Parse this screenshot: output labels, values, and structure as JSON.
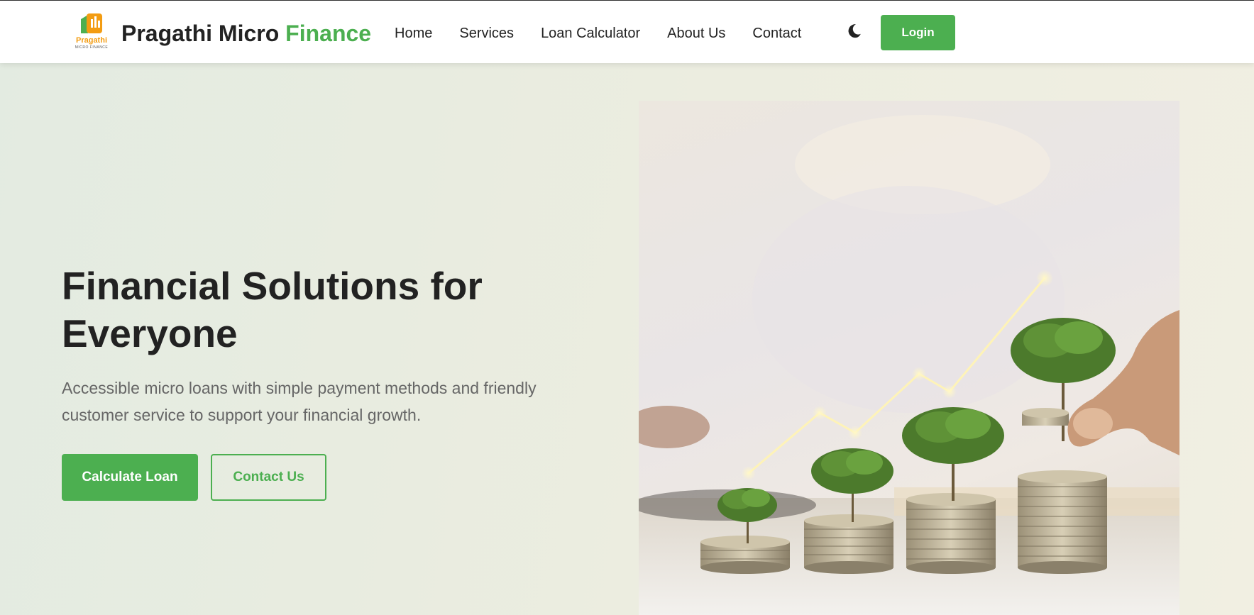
{
  "brand": {
    "logo_text": "Pragathi",
    "logo_subtext": "MICRO FINANCE",
    "name_part1": "Pragathi Micro",
    "name_part2": "Finance",
    "accent_color": "#4caf50",
    "logo_color": "#f39c12"
  },
  "nav": {
    "items": [
      {
        "label": "Home"
      },
      {
        "label": "Services"
      },
      {
        "label": "Loan Calculator"
      },
      {
        "label": "About Us"
      },
      {
        "label": "Contact"
      }
    ],
    "theme_toggle_icon": "moon-icon",
    "login_label": "Login"
  },
  "hero": {
    "title_line1": "Financial Solutions for",
    "title_line2": "Everyone",
    "description_line1": "Accessible micro loans with simple payment methods and friendly",
    "description_line2": "customer service to support your financial growth.",
    "primary_button": "Calculate Loan",
    "secondary_button": "Contact Us",
    "image": "coin-stacks-with-growing-trees-photo"
  }
}
